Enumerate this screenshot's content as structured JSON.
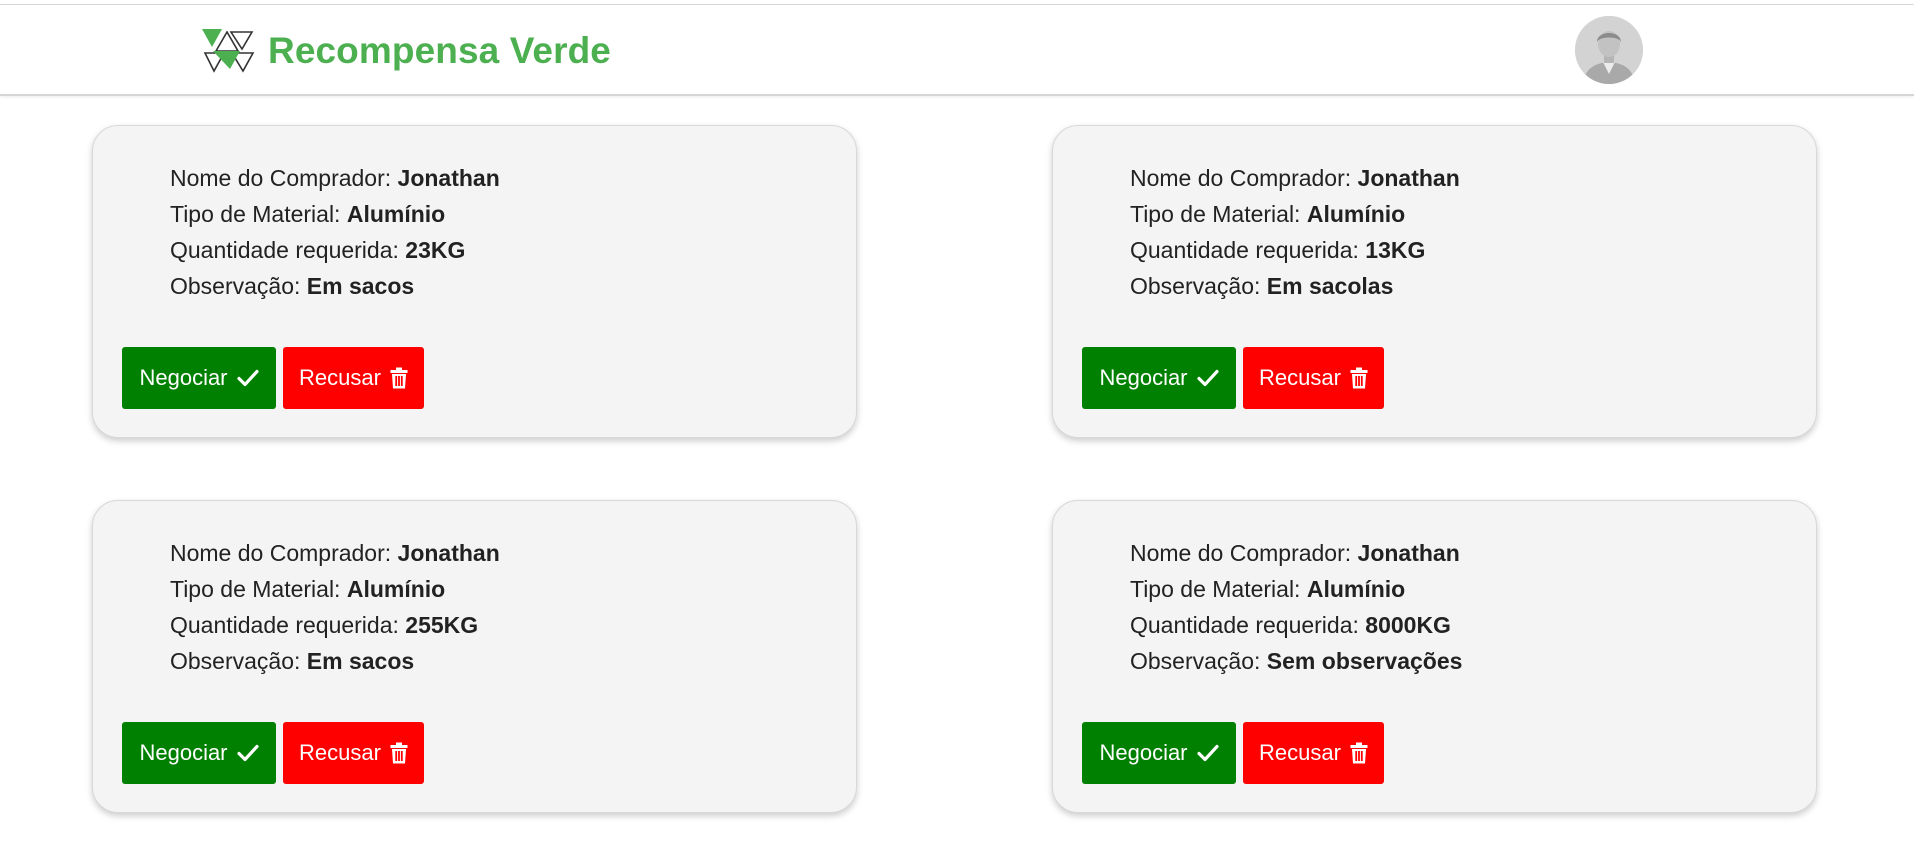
{
  "app": {
    "title": "Recompensa Verde",
    "brand_color": "#4caf50",
    "logo_icon": "recycle-triangles-logo",
    "avatar_icon": "user-avatar-icon"
  },
  "labels": {
    "buyer": "Nome do Comprador: ",
    "material": "Tipo de Material: ",
    "quantity": "Quantidade requerida: ",
    "note": "Observação: "
  },
  "buttons": {
    "negotiate": "Negociar",
    "negotiate_icon": "check-icon",
    "negotiate_color": "#008000",
    "refuse": "Recusar",
    "refuse_icon": "trash-icon",
    "refuse_color": "#ff0000"
  },
  "requests": [
    {
      "buyer": "Jonathan",
      "material": "Alumínio",
      "quantity": "23KG",
      "note": "Em sacos"
    },
    {
      "buyer": "Jonathan",
      "material": "Alumínio",
      "quantity": "13KG",
      "note": "Em sacolas"
    },
    {
      "buyer": "Jonathan",
      "material": "Alumínio",
      "quantity": "255KG",
      "note": "Em sacos"
    },
    {
      "buyer": "Jonathan",
      "material": "Alumínio",
      "quantity": "8000KG",
      "note": "Sem observações"
    }
  ]
}
